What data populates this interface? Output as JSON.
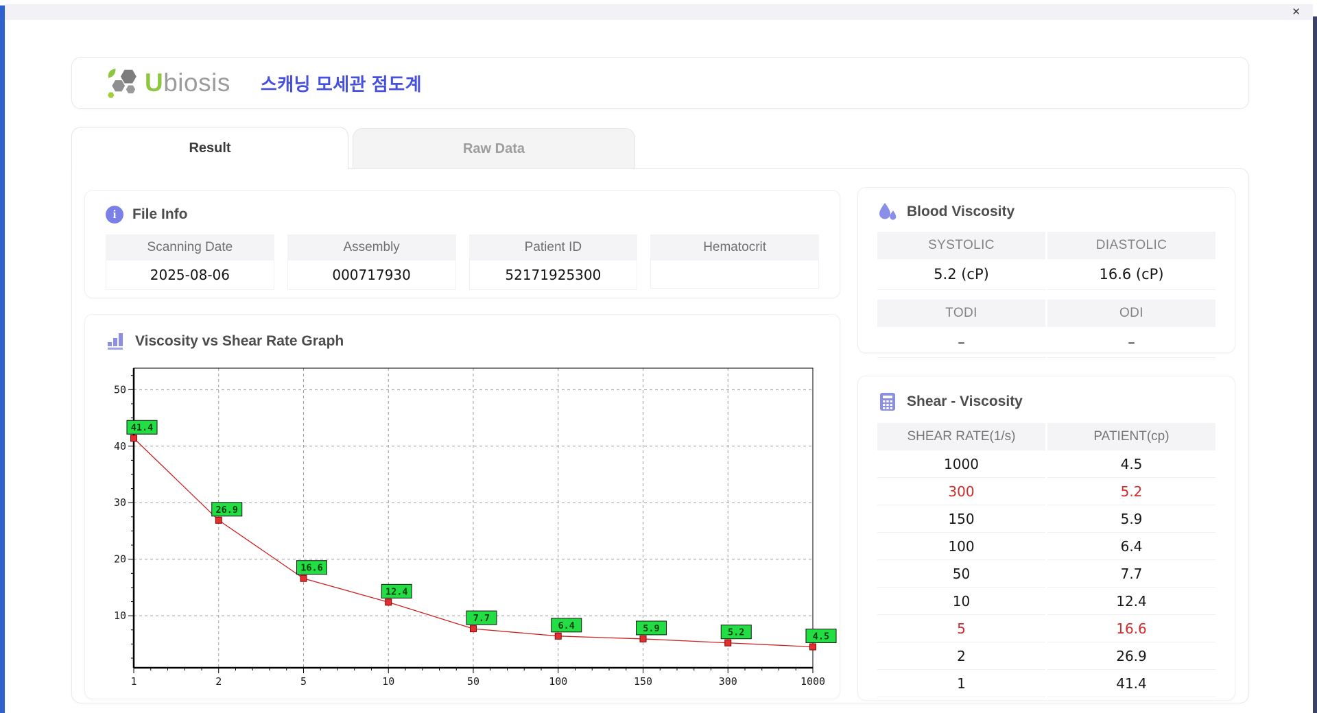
{
  "window": {
    "close": "✕"
  },
  "brand": {
    "logo_u": "U",
    "logo_rest": "biosis",
    "app_title": "스캐닝 모세관 점도계"
  },
  "tabs": {
    "result": "Result",
    "raw": "Raw Data"
  },
  "file_info": {
    "title": "File Info",
    "fields": [
      {
        "label": "Scanning Date",
        "value": "2025-08-06"
      },
      {
        "label": "Assembly",
        "value": "000717930"
      },
      {
        "label": "Patient ID",
        "value": "52171925300"
      },
      {
        "label": "Hematocrit",
        "value": ""
      }
    ]
  },
  "blood_viscosity": {
    "title": "Blood Viscosity",
    "groups": [
      [
        {
          "label": "SYSTOLIC",
          "value": "5.2 (cP)"
        },
        {
          "label": "DIASTOLIC",
          "value": "16.6 (cP)"
        }
      ],
      [
        {
          "label": "TODI",
          "value": "–"
        },
        {
          "label": "ODI",
          "value": "–"
        }
      ]
    ]
  },
  "shear_table": {
    "title": "Shear - Viscosity",
    "columns": [
      "SHEAR RATE(1/s)",
      "PATIENT(cp)"
    ],
    "rows": [
      {
        "shear": "1000",
        "patient": "4.5",
        "highlight": false
      },
      {
        "shear": "300",
        "patient": "5.2",
        "highlight": true
      },
      {
        "shear": "150",
        "patient": "5.9",
        "highlight": false
      },
      {
        "shear": "100",
        "patient": "6.4",
        "highlight": false
      },
      {
        "shear": "50",
        "patient": "7.7",
        "highlight": false
      },
      {
        "shear": "10",
        "patient": "12.4",
        "highlight": false
      },
      {
        "shear": "5",
        "patient": "16.6",
        "highlight": true
      },
      {
        "shear": "2",
        "patient": "26.9",
        "highlight": false
      },
      {
        "shear": "1",
        "patient": "41.4",
        "highlight": false
      }
    ]
  },
  "graph": {
    "title": "Viscosity vs Shear Rate Graph"
  },
  "chart_data": {
    "type": "line",
    "x_scale": "categorical (log-spaced shear rates)",
    "categories": [
      "1",
      "2",
      "5",
      "10",
      "50",
      "100",
      "150",
      "300",
      "1000"
    ],
    "series": [
      {
        "name": "PATIENT(cp)",
        "values": [
          41.4,
          26.9,
          16.6,
          12.4,
          7.7,
          6.4,
          5.9,
          5.2,
          4.5
        ]
      }
    ],
    "point_labels": [
      "41.4",
      "26.9",
      "16.6",
      "12.4",
      "7.7",
      "6.4",
      "5.9",
      "5.2",
      "4.5"
    ],
    "y_tick_labels": [
      10,
      20,
      30,
      40,
      50
    ],
    "ylim": [
      0.8,
      53.8
    ],
    "grid": "dashed",
    "legend": "none"
  },
  "colors": {
    "accent_blue": "#4650dd",
    "brand_green": "#8dc63f",
    "icon_purple": "#8a8ee8",
    "highlight_red": "#cf2b2b",
    "chart_line": "#cc2222",
    "chart_marker": "#e03030",
    "chart_label_bg": "#22dd44",
    "table_header_bg": "#f4f4f6"
  }
}
